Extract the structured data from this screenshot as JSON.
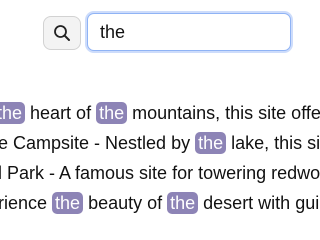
{
  "search": {
    "value": "the",
    "button_icon": "search-icon"
  },
  "results": [
    {
      "segments": [
        {
          "text": "the",
          "highlight": true
        },
        {
          "text": " heart of ",
          "highlight": false
        },
        {
          "text": "the",
          "highlight": true
        },
        {
          "text": " mountains, this site offers s",
          "highlight": false
        }
      ]
    },
    {
      "segments": [
        {
          "text": "e Campsite - Nestled by ",
          "highlight": false
        },
        {
          "text": "the",
          "highlight": true
        },
        {
          "text": " lake, this site i",
          "highlight": false
        }
      ]
    },
    {
      "segments": [
        {
          "text": "l Park - A famous site for towering redwoods",
          "highlight": false
        }
      ]
    },
    {
      "segments": [
        {
          "text": "rience ",
          "highlight": false
        },
        {
          "text": "the",
          "highlight": true
        },
        {
          "text": " beauty of ",
          "highlight": false
        },
        {
          "text": "the",
          "highlight": true
        },
        {
          "text": " desert with guide",
          "highlight": false
        }
      ]
    }
  ],
  "colors": {
    "highlight": "#8d84b6",
    "input_focus_border": "#8fb3f5"
  }
}
